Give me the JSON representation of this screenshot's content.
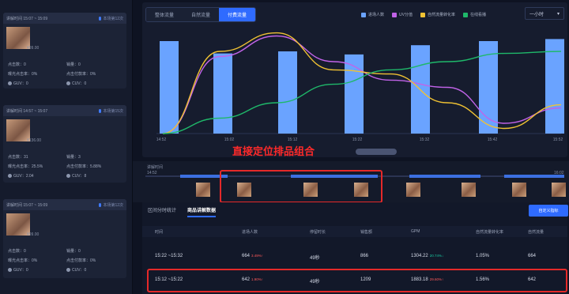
{
  "sidebar": {
    "cards": [
      {
        "time_label": "讲解时间 15:07 ~ 15:09",
        "count_label": "本场第12次",
        "price": "¥99.00",
        "click_count": "点击数：0",
        "sales": "销量：0",
        "exposure_rate": "曝光点击率：0%",
        "click_conversion": "点击付款率：0%",
        "guv": "GUV：0",
        "cuv": "CUV：0"
      },
      {
        "time_label": "讲解时间 14:57 ~ 15:07",
        "count_label": "本场第15次",
        "price": "¥136.00",
        "click_count": "点击数：31",
        "sales": "销量：3",
        "exposure_rate": "曝光点击率：25.5%",
        "click_conversion": "点击付款率：5.88%",
        "guv": "GUV：2.04",
        "cuv": "CUV：8"
      },
      {
        "time_label": "讲解时间 15:07 ~ 15:09",
        "count_label": "本场第12次",
        "price": "¥99.00",
        "click_count": "点击数：0",
        "sales": "销量：0",
        "exposure_rate": "曝光点击率：0%",
        "click_conversion": "点击付款率：0%",
        "guv": "GUV：0",
        "cuv": "CUV：0"
      }
    ]
  },
  "chart": {
    "tabs": [
      "整体流量",
      "自然流量",
      "付费流量"
    ],
    "active_tab": "付费流量",
    "legend": [
      {
        "name": "进场人数",
        "color": "#6aa3ff"
      },
      {
        "name": "UV分值",
        "color": "#c163e8"
      },
      {
        "name": "自然流量转化率",
        "color": "#f0c233"
      },
      {
        "name": "在线看播",
        "color": "#1fb86a"
      }
    ],
    "range_select": "一小时",
    "chevron_icon": "chevron-down-icon"
  },
  "chart_data": {
    "type": "bar",
    "categories": [
      "14:52",
      "",
      "15:02",
      "",
      "15:12",
      "",
      "15:22",
      "",
      "15:32",
      "",
      "15:42",
      "",
      "15:52"
    ],
    "x_tick_labels": [
      "14:52",
      "15:02",
      "15:12",
      "15:22",
      "15:32",
      "15:42",
      "15:52"
    ],
    "bar_values": [
      0.9,
      0.78,
      0.8,
      0.77,
      0.86,
      0.9,
      0.92
    ],
    "series": [
      {
        "name": "UV分值",
        "type": "line",
        "color": "#c163e8",
        "values": [
          0.0,
          0.75,
          0.95,
          0.7,
          0.52,
          0.45,
          0.1,
          0.25
        ]
      },
      {
        "name": "自然流量转化率",
        "type": "line",
        "color": "#f0c233",
        "values": [
          0.0,
          0.8,
          0.98,
          0.62,
          0.58,
          0.3,
          0.05,
          0.28
        ]
      },
      {
        "name": "在线看播",
        "type": "line",
        "color": "#1fb86a",
        "values": [
          0.0,
          0.15,
          0.3,
          0.48,
          0.62,
          0.7,
          0.78,
          0.8
        ]
      }
    ],
    "ylim": [
      0,
      1
    ]
  },
  "annotation": {
    "text": "直接定位排品组合"
  },
  "timeline": {
    "label": "讲解时间",
    "start": "14:52",
    "end": "16:02"
  },
  "detail": {
    "tabs": [
      "区间分时统计",
      "商品讲解数据"
    ],
    "active_tab": "商品讲解数据",
    "custom_button": "自定义指标",
    "columns": [
      "时间",
      "进场人数",
      "停留时长",
      "销售额",
      "GPM",
      "自然流量转化率",
      "自然流量"
    ],
    "rows": [
      {
        "time": "15:22 ~15:32",
        "visitors": "664",
        "visitors_pct": "3.49%↑",
        "stay": "49秒",
        "sales": "866",
        "gpm": "1304.22",
        "gpm_pct": "20.74%↓",
        "conv": "1.05%",
        "natural": "664"
      },
      {
        "time": "15:12 ~15:22",
        "visitors": "642",
        "visitors_pct": "1.90%↑",
        "stay": "49秒",
        "sales": "1209",
        "gpm": "1883.18",
        "gpm_pct": "29.60%↑",
        "conv": "1.56%",
        "natural": "642"
      }
    ]
  }
}
